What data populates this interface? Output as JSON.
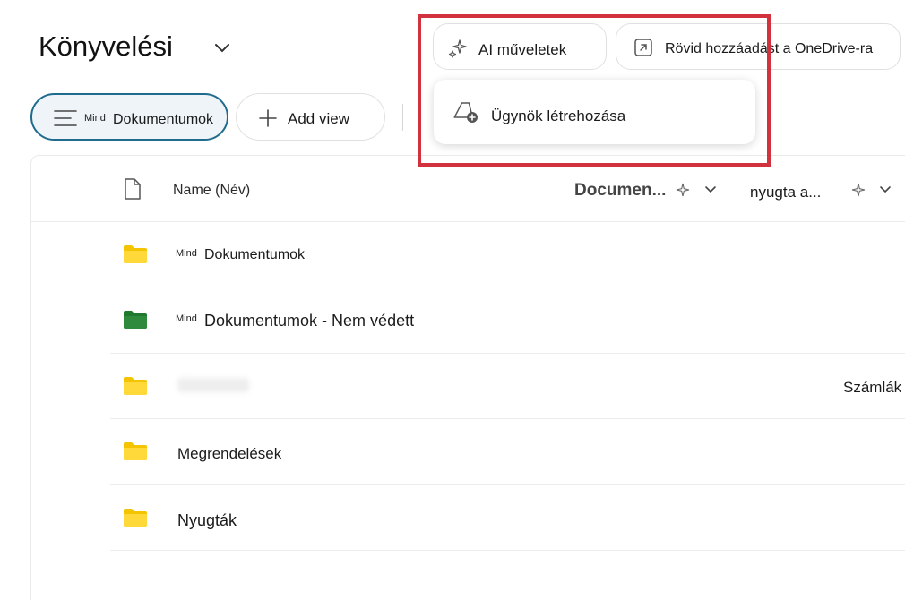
{
  "header": {
    "title": "Könyvelési"
  },
  "toolbar": {
    "ai_label": "AI műveletek",
    "shortcut_label": "Rövid hozzáadást a OneDrive-ra",
    "view_small": "Mind",
    "view_label": "Dokumentumok",
    "add_view_label": "Add view"
  },
  "dropdown": {
    "item_label": "Ügynök létrehozása"
  },
  "columns": {
    "name": "Name (Név)",
    "documents": "Documen...",
    "receipts": "nyugta a..."
  },
  "rows": [
    {
      "prefix": "Mind",
      "name": "Dokumentumok",
      "color": "yellow"
    },
    {
      "prefix": "Mind",
      "name": "Dokumentumok - Nem védett",
      "color": "green"
    },
    {
      "prefix": "",
      "name": "",
      "extra": "Számlák",
      "color": "yellow"
    },
    {
      "prefix": "",
      "name": "Megrendelések",
      "color": "yellow"
    },
    {
      "prefix": "",
      "name": "Nyugták",
      "color": "yellow"
    }
  ],
  "colors": {
    "accent": "#1f6b8e",
    "highlight": "#d1323e",
    "folder_yellow": "#f5c400",
    "folder_green": "#2e8b3d"
  },
  "icons": [
    "chevron-down-icon",
    "sparkle-icon",
    "arrow-up-right-icon",
    "list-icon",
    "plus-icon",
    "file-icon",
    "folder-icon",
    "agent-create-icon"
  ]
}
